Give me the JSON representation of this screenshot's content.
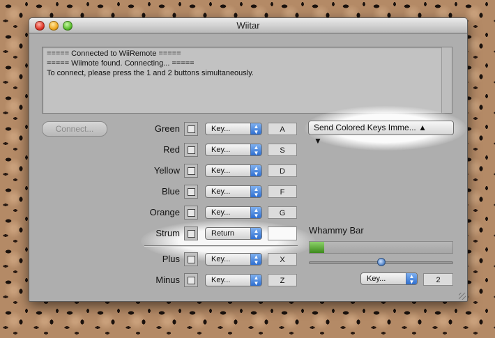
{
  "window": {
    "title": "Wiitar"
  },
  "log": {
    "lines": [
      "===== Connected to WiiRemote =====",
      "===== Wiimote found. Connecting... =====",
      "To connect, please press the 1 and 2 buttons simultaneously."
    ]
  },
  "connect_button": {
    "label": "Connect...",
    "enabled": false
  },
  "send_popup": {
    "label": "Send Colored Keys Imme..."
  },
  "rows": [
    {
      "label": "Green",
      "popup": "Key...",
      "key": "A"
    },
    {
      "label": "Red",
      "popup": "Key...",
      "key": "S"
    },
    {
      "label": "Yellow",
      "popup": "Key...",
      "key": "D"
    },
    {
      "label": "Blue",
      "popup": "Key...",
      "key": "F"
    },
    {
      "label": "Orange",
      "popup": "Key...",
      "key": "G"
    },
    {
      "label": "Strum",
      "popup": "Return",
      "key": ""
    },
    {
      "label": "Plus",
      "popup": "Key...",
      "key": "X"
    },
    {
      "label": "Minus",
      "popup": "Key...",
      "key": "Z"
    }
  ],
  "whammy": {
    "label": "Whammy Bar",
    "level_fraction": 0.1,
    "slider_fraction": 0.5,
    "popup": "Key...",
    "value": "2"
  },
  "colors": {
    "accent": "#2f6fd0",
    "whammy_fill": "#3d8a1c"
  },
  "icons": [
    "close-icon",
    "minimize-icon",
    "zoom-icon",
    "popup-arrows-icon",
    "resize-grip-icon"
  ]
}
